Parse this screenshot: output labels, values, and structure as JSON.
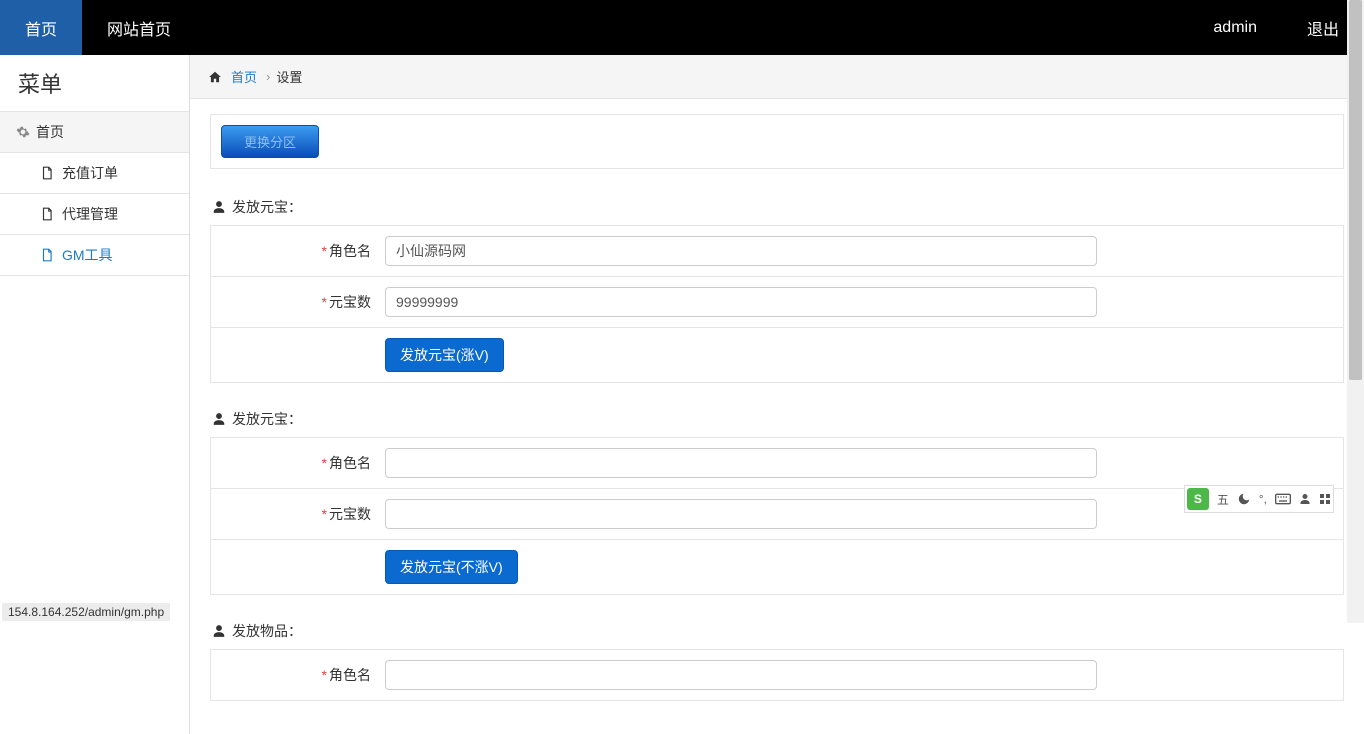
{
  "topnav": {
    "home": "首页",
    "site_home": "网站首页",
    "user": "admin",
    "logout": "退出"
  },
  "sidebar": {
    "title": "菜单",
    "parent": "首页",
    "items": [
      {
        "label": "充值订单"
      },
      {
        "label": "代理管理"
      },
      {
        "label": "GM工具"
      }
    ]
  },
  "breadcrumb": {
    "link": "首页",
    "current": "设置"
  },
  "switch_zone": "更换分区",
  "sections": [
    {
      "title": "发放元宝："
    },
    {
      "title": "发放元宝："
    },
    {
      "title": "发放物品："
    }
  ],
  "form1": {
    "role_label": "角色名",
    "role_value": "小仙源码网",
    "amount_label": "元宝数",
    "amount_value": "99999999",
    "button": "发放元宝(涨V)"
  },
  "form2": {
    "role_label": "角色名",
    "role_value": "",
    "amount_label": "元宝数",
    "amount_value": "",
    "button": "发放元宝(不涨V)"
  },
  "form3": {
    "role_label": "角色名",
    "role_value": ""
  },
  "ime": {
    "label": "五"
  },
  "status": "154.8.164.252/admin/gm.php"
}
